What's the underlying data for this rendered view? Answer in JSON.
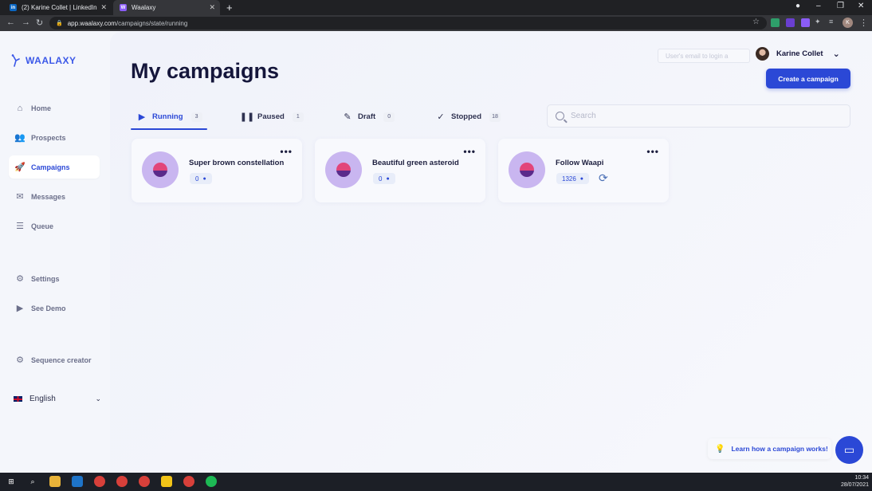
{
  "browser": {
    "tabs": [
      {
        "label": "(2) Karine Collet | LinkedIn",
        "favicon": "in"
      },
      {
        "label": "Waalaxy",
        "favicon": "W"
      }
    ],
    "url_host": "app.waalaxy.com",
    "url_path": "/campaigns/state/running",
    "profile_initial": "K"
  },
  "sidebar": {
    "logo": "WAALAXY",
    "items": [
      {
        "label": "Home",
        "icon": "home-icon"
      },
      {
        "label": "Prospects",
        "icon": "users-icon"
      },
      {
        "label": "Campaigns",
        "icon": "rocket-icon"
      },
      {
        "label": "Messages",
        "icon": "mail-icon"
      },
      {
        "label": "Queue",
        "icon": "list-icon"
      },
      {
        "label": "Settings",
        "icon": "gear-icon"
      },
      {
        "label": "See Demo",
        "icon": "play-icon"
      },
      {
        "label": "Sequence creator",
        "icon": "gear-icon"
      }
    ],
    "language": "English"
  },
  "header": {
    "title": "My campaigns",
    "login_placeholder": "User's email to login a",
    "user_name": "Karine Collet",
    "create_button": "Create a campaign"
  },
  "tabs": [
    {
      "label": "Running",
      "count": "3"
    },
    {
      "label": "Paused",
      "count": "1"
    },
    {
      "label": "Draft",
      "count": "0"
    },
    {
      "label": "Stopped",
      "count": "18"
    }
  ],
  "search": {
    "placeholder": "Search"
  },
  "campaigns": [
    {
      "name": "Super brown constellation",
      "count": "0"
    },
    {
      "name": "Beautiful green asteroid",
      "count": "0"
    },
    {
      "name": "Follow Waapi",
      "count": "1326"
    }
  ],
  "help": {
    "learn_label": "Learn how a campaign works!"
  },
  "taskbar": {
    "time": "10:34",
    "date": "28/07/2021"
  },
  "colors": {
    "accent": "#2b48d6",
    "avatar_bg": "#c9b6f0"
  }
}
